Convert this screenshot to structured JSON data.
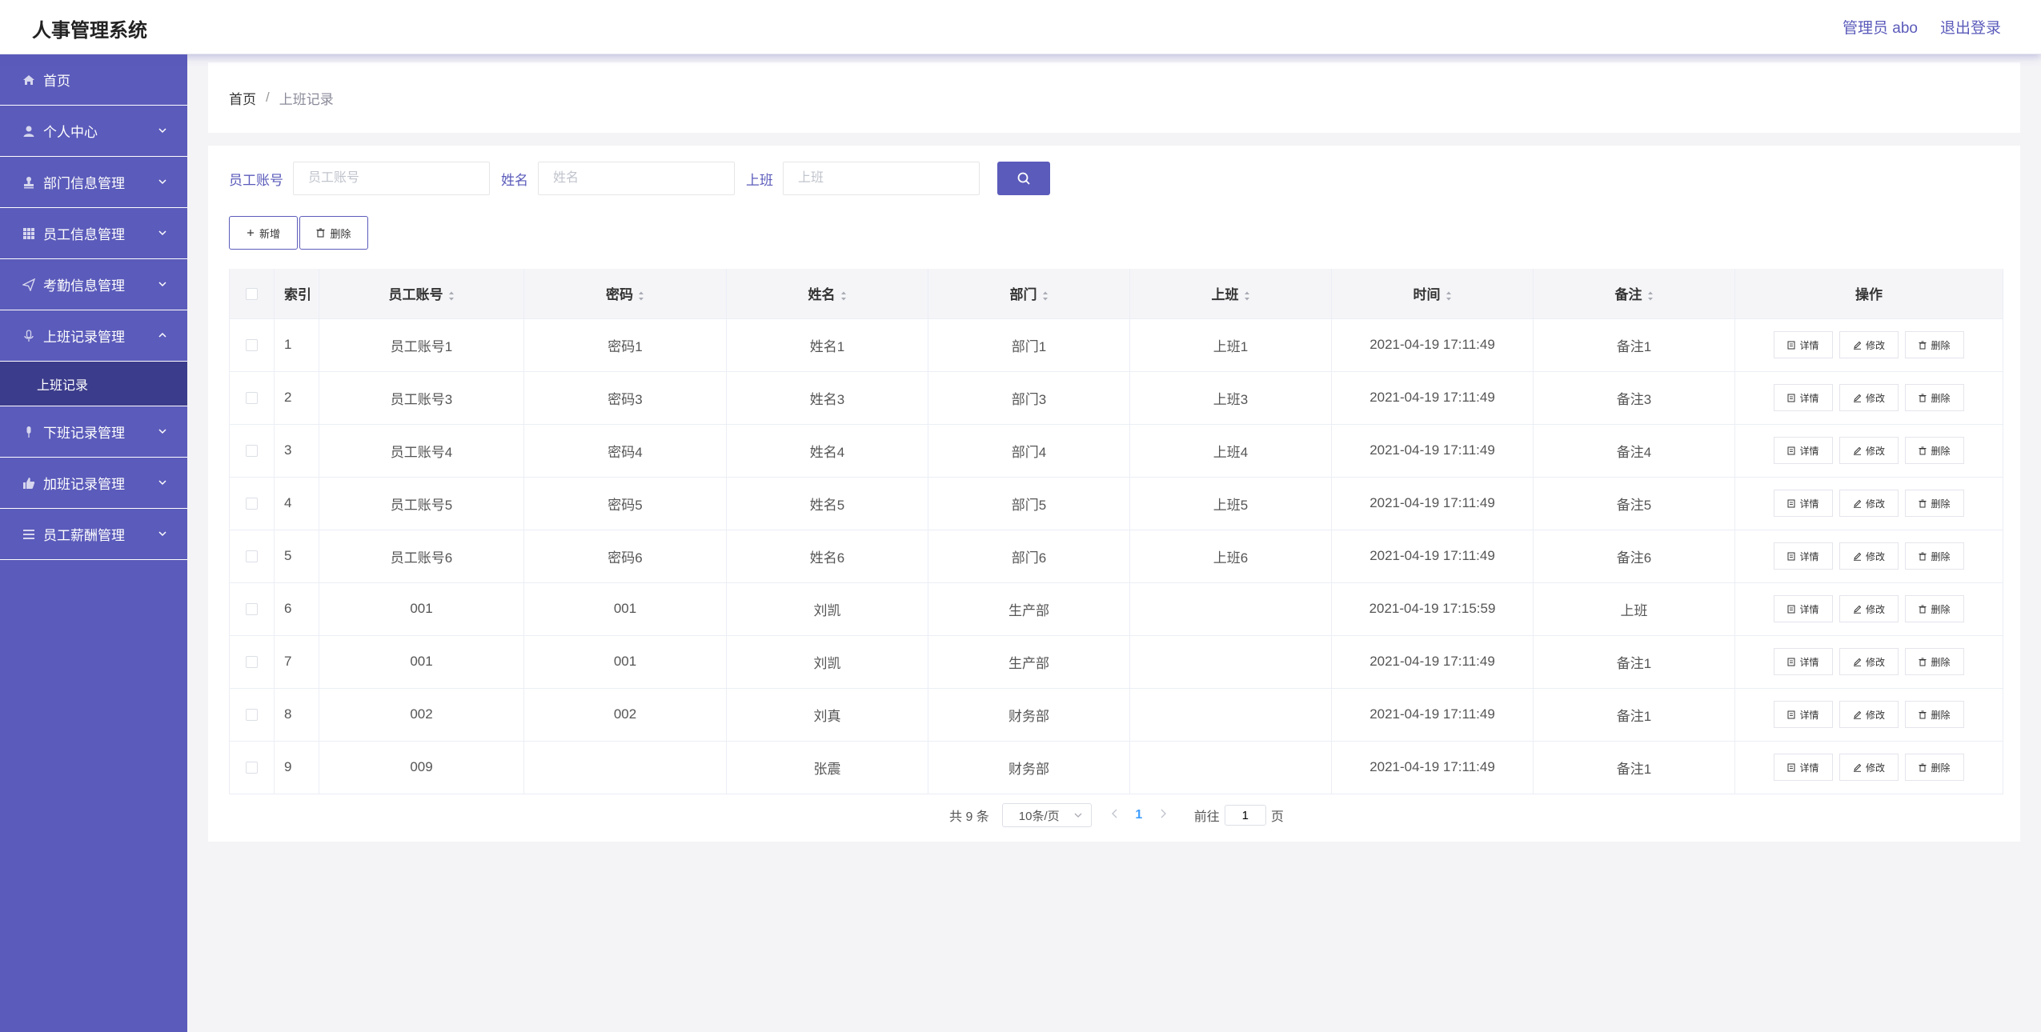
{
  "header": {
    "title": "人事管理系统",
    "user_label": "管理员 abo",
    "logout_label": "退出登录"
  },
  "sidebar": {
    "items": [
      {
        "label": "首页",
        "icon": "home-icon"
      },
      {
        "label": "个人中心",
        "icon": "user-icon"
      },
      {
        "label": "部门信息管理",
        "icon": "stamp-icon"
      },
      {
        "label": "员工信息管理",
        "icon": "grid-icon"
      },
      {
        "label": "考勤信息管理",
        "icon": "send-icon"
      },
      {
        "label": "上班记录管理",
        "icon": "mic-icon",
        "expanded": true
      },
      {
        "label": "下班记录管理",
        "icon": "mic-icon"
      },
      {
        "label": "加班记录管理",
        "icon": "thumb-up-icon"
      },
      {
        "label": "员工薪酬管理",
        "icon": "menu-icon"
      }
    ],
    "sub_item": "上班记录"
  },
  "breadcrumb": {
    "home": "首页",
    "separator": "/",
    "current": "上班记录"
  },
  "search": {
    "account_label": "员工账号",
    "account_placeholder": "员工账号",
    "name_label": "姓名",
    "name_placeholder": "姓名",
    "shift_label": "上班",
    "shift_placeholder": "上班"
  },
  "actions": {
    "add_label": "新增",
    "delete_label": "删除"
  },
  "table": {
    "columns": [
      "索引",
      "员工账号",
      "密码",
      "姓名",
      "部门",
      "上班",
      "时间",
      "备注",
      "操作"
    ],
    "op_labels": {
      "detail": "详情",
      "edit": "修改",
      "delete": "删除"
    },
    "rows": [
      {
        "index": "1",
        "account": "员工账号1",
        "password": "密码1",
        "name": "姓名1",
        "dept": "部门1",
        "shift": "上班1",
        "time": "2021-04-19 17:11:49",
        "note": "备注1"
      },
      {
        "index": "2",
        "account": "员工账号3",
        "password": "密码3",
        "name": "姓名3",
        "dept": "部门3",
        "shift": "上班3",
        "time": "2021-04-19 17:11:49",
        "note": "备注3"
      },
      {
        "index": "3",
        "account": "员工账号4",
        "password": "密码4",
        "name": "姓名4",
        "dept": "部门4",
        "shift": "上班4",
        "time": "2021-04-19 17:11:49",
        "note": "备注4"
      },
      {
        "index": "4",
        "account": "员工账号5",
        "password": "密码5",
        "name": "姓名5",
        "dept": "部门5",
        "shift": "上班5",
        "time": "2021-04-19 17:11:49",
        "note": "备注5"
      },
      {
        "index": "5",
        "account": "员工账号6",
        "password": "密码6",
        "name": "姓名6",
        "dept": "部门6",
        "shift": "上班6",
        "time": "2021-04-19 17:11:49",
        "note": "备注6"
      },
      {
        "index": "6",
        "account": "001",
        "password": "001",
        "name": "刘凯",
        "dept": "生产部",
        "shift": "",
        "time": "2021-04-19 17:15:59",
        "note": "上班"
      },
      {
        "index": "7",
        "account": "001",
        "password": "001",
        "name": "刘凯",
        "dept": "生产部",
        "shift": "",
        "time": "2021-04-19 17:11:49",
        "note": "备注1"
      },
      {
        "index": "8",
        "account": "002",
        "password": "002",
        "name": "刘真",
        "dept": "财务部",
        "shift": "",
        "time": "2021-04-19 17:11:49",
        "note": "备注1"
      },
      {
        "index": "9",
        "account": "009",
        "password": "",
        "name": "张震",
        "dept": "财务部",
        "shift": "",
        "time": "2021-04-19 17:11:49",
        "note": "备注1"
      }
    ]
  },
  "pagination": {
    "total_text": "共 9 条",
    "page_size": "10条/页",
    "current_page": "1",
    "goto_prefix": "前往",
    "goto_value": "1",
    "goto_suffix": "页"
  },
  "colors": {
    "primary": "#5b5bbb",
    "submenu_active": "#3c3c8c",
    "page_active": "#409eff"
  }
}
